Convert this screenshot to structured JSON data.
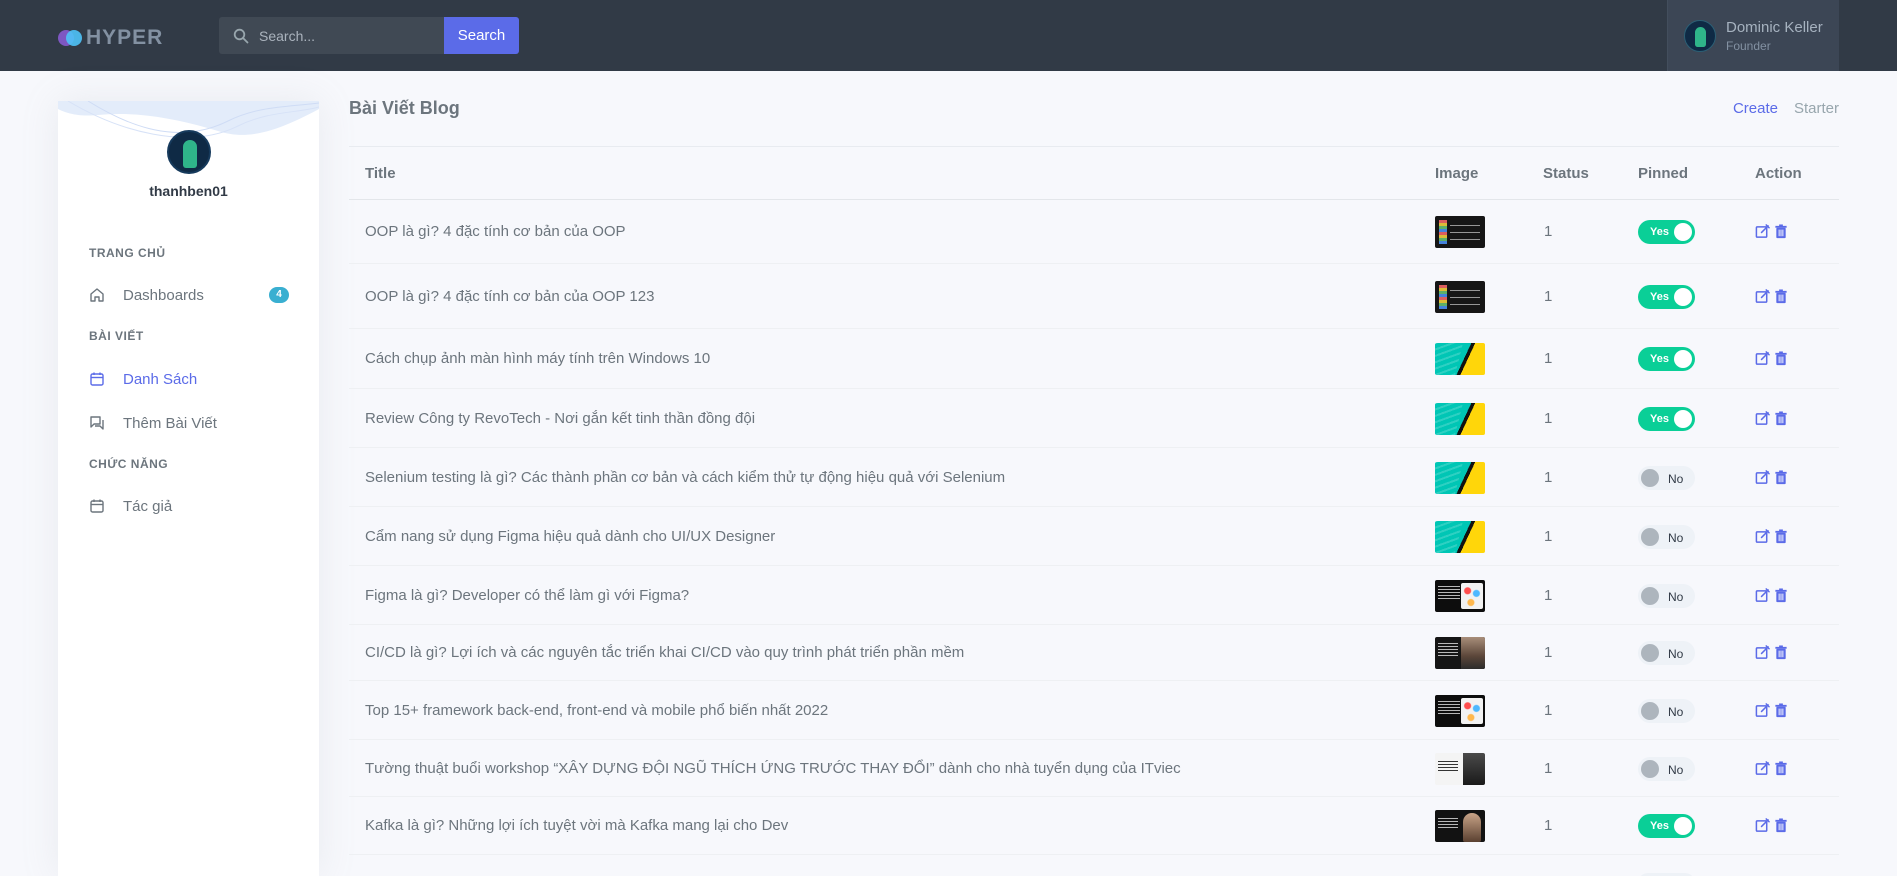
{
  "app": {
    "logo_text": "HYPER"
  },
  "search": {
    "placeholder": "Search...",
    "button_label": "Search"
  },
  "user": {
    "name": "Dominic Keller",
    "role": "Founder"
  },
  "sidebar": {
    "profile_name": "thanhben01",
    "sections": [
      {
        "title": "TRANG CHỦ",
        "items": [
          {
            "label": "Dashboards",
            "icon": "home-icon",
            "badge": "4",
            "active": false
          }
        ]
      },
      {
        "title": "BÀI VIẾT",
        "items": [
          {
            "label": "Danh Sách",
            "icon": "calendar-icon",
            "active": true
          },
          {
            "label": "Thêm Bài Viết",
            "icon": "chat-icon",
            "active": false
          }
        ]
      },
      {
        "title": "CHỨC NĂNG",
        "items": [
          {
            "label": "Tác giả",
            "icon": "calendar-icon",
            "active": false
          }
        ]
      }
    ]
  },
  "page": {
    "title": "Bài Viết Blog",
    "breadcrumb": {
      "create": "Create",
      "starter": "Starter"
    }
  },
  "table": {
    "headers": {
      "title": "Title",
      "image": "Image",
      "status": "Status",
      "pinned": "Pinned",
      "action": "Action"
    },
    "rows": [
      {
        "title": "OOP là gì? 4 đặc tính cơ bản của OOP",
        "image": "oop",
        "status": "1",
        "pinned": "Yes"
      },
      {
        "title": "OOP là gì? 4 đặc tính cơ bản của OOP 123",
        "image": "oop",
        "status": "1",
        "pinned": "Yes"
      },
      {
        "title": "Cách chụp ảnh màn hình máy tính trên Windows 10",
        "image": "stripe",
        "status": "1",
        "pinned": "Yes"
      },
      {
        "title": "Review Công ty RevoTech - Nơi gắn kết tinh thần đồng đội",
        "image": "stripe",
        "status": "1",
        "pinned": "Yes"
      },
      {
        "title": "Selenium testing là gì? Các thành phần cơ bản và cách kiểm thử tự động hiệu quả với Selenium",
        "image": "stripe",
        "status": "1",
        "pinned": "No"
      },
      {
        "title": "Cẩm nang sử dụng Figma hiệu quả dành cho UI/UX Designer",
        "image": "stripe",
        "status": "1",
        "pinned": "No"
      },
      {
        "title": "Figma là gì? Developer có thể làm gì với Figma?",
        "image": "dark",
        "status": "1",
        "pinned": "No"
      },
      {
        "title": "CI/CD là gì? Lợi ích và các nguyên tắc triển khai CI/CD vào quy trình phát triển phần mềm",
        "image": "photo",
        "status": "1",
        "pinned": "No"
      },
      {
        "title": "Top 15+ framework back-end, front-end và mobile phổ biến nhất 2022",
        "image": "dark",
        "status": "1",
        "pinned": "No"
      },
      {
        "title": "Tường thuật buổi workshop “XÂY DỰNG ĐỘI NGŨ THÍCH ỨNG TRƯỚC THAY ĐỔI” dành cho nhà tuyển dụng của ITviec",
        "image": "white",
        "status": "1",
        "pinned": "No"
      },
      {
        "title": "Kafka là gì? Những lợi ích tuyệt vời mà Kafka mang lại cho Dev",
        "image": "kafka",
        "status": "1",
        "pinned": "Yes"
      }
    ]
  },
  "colors": {
    "topbar": "#313a46",
    "accent": "#5b6be8",
    "success": "#0acf97",
    "info": "#39afd1"
  }
}
